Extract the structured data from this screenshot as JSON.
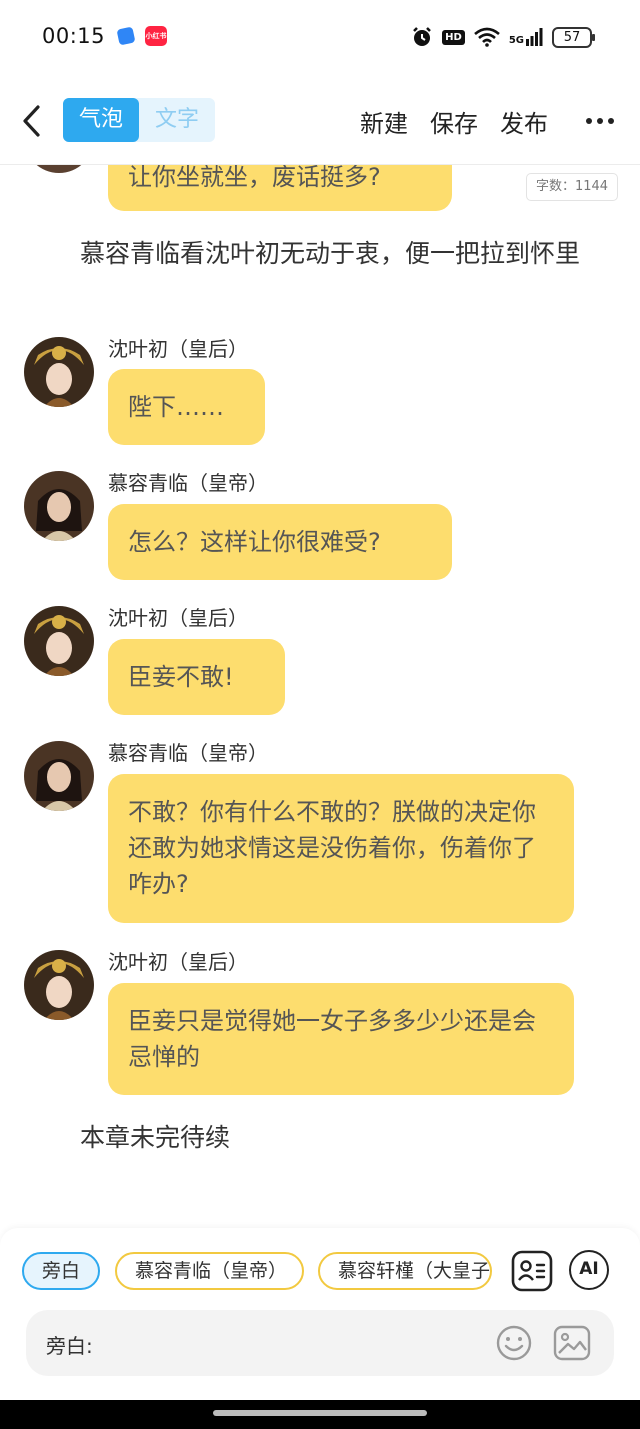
{
  "status_bar": {
    "time": "00:15",
    "app_badge_text": "小红书",
    "hd_label": "HD",
    "network_label": "5G",
    "battery": "57"
  },
  "toolbar": {
    "mode_tabs": [
      "气泡",
      "文字"
    ],
    "active_mode": "气泡",
    "actions": [
      "新建",
      "保存",
      "发布"
    ],
    "more_icon": "more-dots-icon"
  },
  "word_count": "字数：1144",
  "chat": {
    "top_partial_bubble": "让你坐就坐，废话挺多?",
    "narration": "慕容青临看沈叶初无动于衷，便一把拉到怀里",
    "messages": [
      {
        "speaker": "沈叶初（皇后）",
        "text": "陛下……",
        "avatar": "empress"
      },
      {
        "speaker": "慕容青临（皇帝）",
        "text": "怎么？这样让你很难受?",
        "avatar": "emperor"
      },
      {
        "speaker": "沈叶初（皇后）",
        "text": "臣妾不敢!",
        "avatar": "empress"
      },
      {
        "speaker": "慕容青临（皇帝）",
        "text": "不敢？你有什么不敢的？朕做的决定你还敢为她求情这是没伤着你，伤着你了咋办?",
        "avatar": "emperor"
      },
      {
        "speaker": "沈叶初（皇后）",
        "text": "臣妾只是觉得她一女子多多少少还是会忌惮的",
        "avatar": "empress"
      }
    ],
    "ending": "本章未完待续"
  },
  "bottom": {
    "roles": [
      "旁白",
      "慕容青临（皇帝）",
      "慕容轩槿（大皇子）"
    ],
    "selected_role": "旁白",
    "ai_label": "AI",
    "input_label": "旁白:"
  },
  "colors": {
    "accent_blue": "#2ea9ef",
    "bubble_yellow": "#fddd6e",
    "chip_border": "#f2c940"
  }
}
